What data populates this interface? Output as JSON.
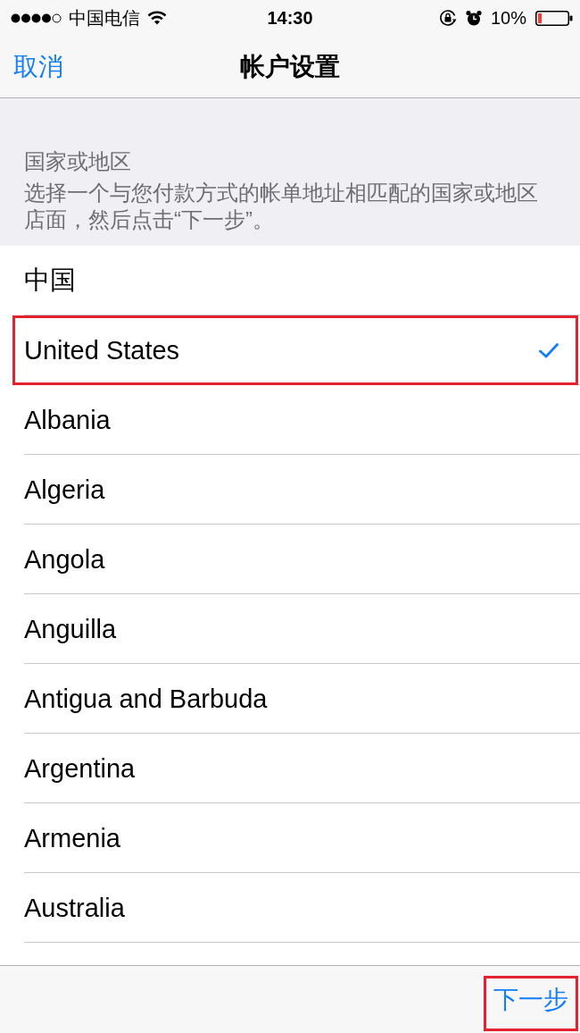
{
  "status_bar": {
    "carrier": "中国电信",
    "time": "14:30",
    "battery": "10%"
  },
  "nav_bar": {
    "cancel": "取消",
    "title": "帐户设置"
  },
  "section": {
    "header": "国家或地区",
    "description": "选择一个与您付款方式的帐单地址相匹配的国家或地区店面，然后点击“下一步”。"
  },
  "countries": [
    {
      "name": "中国",
      "selected": false,
      "highlighted": false
    },
    {
      "name": "United States",
      "selected": true,
      "highlighted": true
    },
    {
      "name": "Albania",
      "selected": false,
      "highlighted": false
    },
    {
      "name": "Algeria",
      "selected": false,
      "highlighted": false
    },
    {
      "name": "Angola",
      "selected": false,
      "highlighted": false
    },
    {
      "name": "Anguilla",
      "selected": false,
      "highlighted": false
    },
    {
      "name": "Antigua and Barbuda",
      "selected": false,
      "highlighted": false
    },
    {
      "name": "Argentina",
      "selected": false,
      "highlighted": false
    },
    {
      "name": "Armenia",
      "selected": false,
      "highlighted": false
    },
    {
      "name": "Australia",
      "selected": false,
      "highlighted": false
    }
  ],
  "toolbar": {
    "next": {
      "label": "下一步",
      "highlighted": true
    }
  }
}
